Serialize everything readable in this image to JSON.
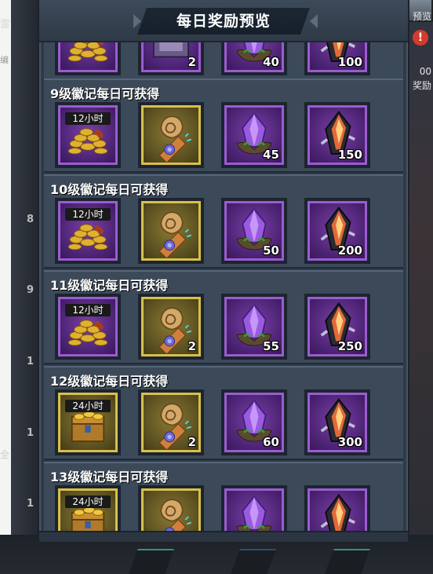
{
  "background": {
    "left_texts": [
      "雷",
      "编",
      "全"
    ],
    "left_nums": [
      "8",
      "9",
      "1",
      "1",
      "1"
    ],
    "right_texts": [
      "预览",
      "00",
      "奖励"
    ],
    "badge": "!"
  },
  "panel": {
    "title": "每日奖励预览"
  },
  "partial_row": {
    "items": [
      {
        "icon": "gold-coins-pile",
        "frame": "purple",
        "qty": ""
      },
      {
        "icon": "scroll-chest",
        "frame": "purple",
        "qty": "2"
      },
      {
        "icon": "purple-crystal",
        "frame": "purple",
        "qty": "40"
      },
      {
        "icon": "fire-crystal",
        "frame": "purple",
        "qty": "100"
      }
    ]
  },
  "sections": [
    {
      "title": "9级徽记每日可获得",
      "items": [
        {
          "icon": "gold-coins-pile",
          "frame": "purple",
          "time": "12小时",
          "qty": ""
        },
        {
          "icon": "rose-scroll",
          "frame": "gold",
          "qty": ""
        },
        {
          "icon": "purple-crystal",
          "frame": "purple",
          "qty": "45"
        },
        {
          "icon": "fire-crystal",
          "frame": "purple",
          "qty": "150"
        }
      ]
    },
    {
      "title": "10级徽记每日可获得",
      "items": [
        {
          "icon": "gold-coins-pile",
          "frame": "purple",
          "time": "12小时",
          "qty": ""
        },
        {
          "icon": "rose-scroll",
          "frame": "gold",
          "qty": ""
        },
        {
          "icon": "purple-crystal",
          "frame": "purple",
          "qty": "50"
        },
        {
          "icon": "fire-crystal",
          "frame": "purple",
          "qty": "200"
        }
      ]
    },
    {
      "title": "11级徽记每日可获得",
      "items": [
        {
          "icon": "gold-coins-pile",
          "frame": "purple",
          "time": "12小时",
          "qty": ""
        },
        {
          "icon": "rose-scroll",
          "frame": "gold",
          "qty": "2"
        },
        {
          "icon": "purple-crystal",
          "frame": "purple",
          "qty": "55"
        },
        {
          "icon": "fire-crystal",
          "frame": "purple",
          "qty": "250"
        }
      ]
    },
    {
      "title": "12级徽记每日可获得",
      "items": [
        {
          "icon": "gold-treasure-chest",
          "frame": "gold",
          "time": "24小时",
          "qty": ""
        },
        {
          "icon": "rose-scroll",
          "frame": "gold",
          "qty": "2"
        },
        {
          "icon": "purple-crystal",
          "frame": "purple",
          "qty": "60"
        },
        {
          "icon": "fire-crystal",
          "frame": "purple",
          "qty": "300"
        }
      ]
    },
    {
      "title": "13级徽记每日可获得",
      "items": [
        {
          "icon": "gold-treasure-chest",
          "frame": "gold",
          "time": "24小时",
          "qty": ""
        },
        {
          "icon": "rose-scroll",
          "frame": "gold",
          "qty": ""
        },
        {
          "icon": "purple-crystal",
          "frame": "purple",
          "qty": ""
        },
        {
          "icon": "fire-crystal",
          "frame": "purple",
          "qty": ""
        }
      ]
    }
  ]
}
